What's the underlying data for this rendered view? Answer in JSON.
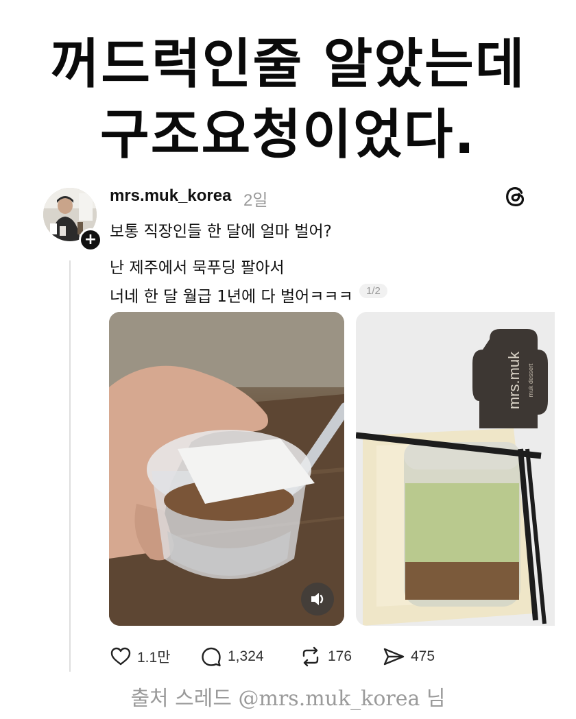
{
  "headline": {
    "line1": "꺼드럭인줄 알았는데",
    "line2": "구조요청이었다."
  },
  "post": {
    "username": "mrs.muk_korea",
    "time": "2일",
    "lines": [
      "보통 직장인들 한 달에 얼마 벌어?",
      "난 제주에서 묵푸딩 팔아서",
      "너네 한 달 월급 1년에 다 벌어ㅋㅋㅋ"
    ],
    "page_indicator": "1/2",
    "package_brand": "mrs.muk",
    "package_sub": "muk dessert",
    "actions": {
      "likes": "1.1만",
      "replies": "1,324",
      "reposts": "176",
      "shares": "475"
    }
  },
  "source_caption": "출처 스레드 @mrs.muk_korea 님",
  "icons": {
    "threads": "threads-logo-icon",
    "follow": "plus-icon",
    "sound": "speaker-icon",
    "like": "heart-icon",
    "reply": "comment-icon",
    "repost": "repost-icon",
    "share": "send-icon"
  },
  "colors": {
    "text": "#111111",
    "muted": "#999999",
    "caption": "#9a9a9a"
  }
}
